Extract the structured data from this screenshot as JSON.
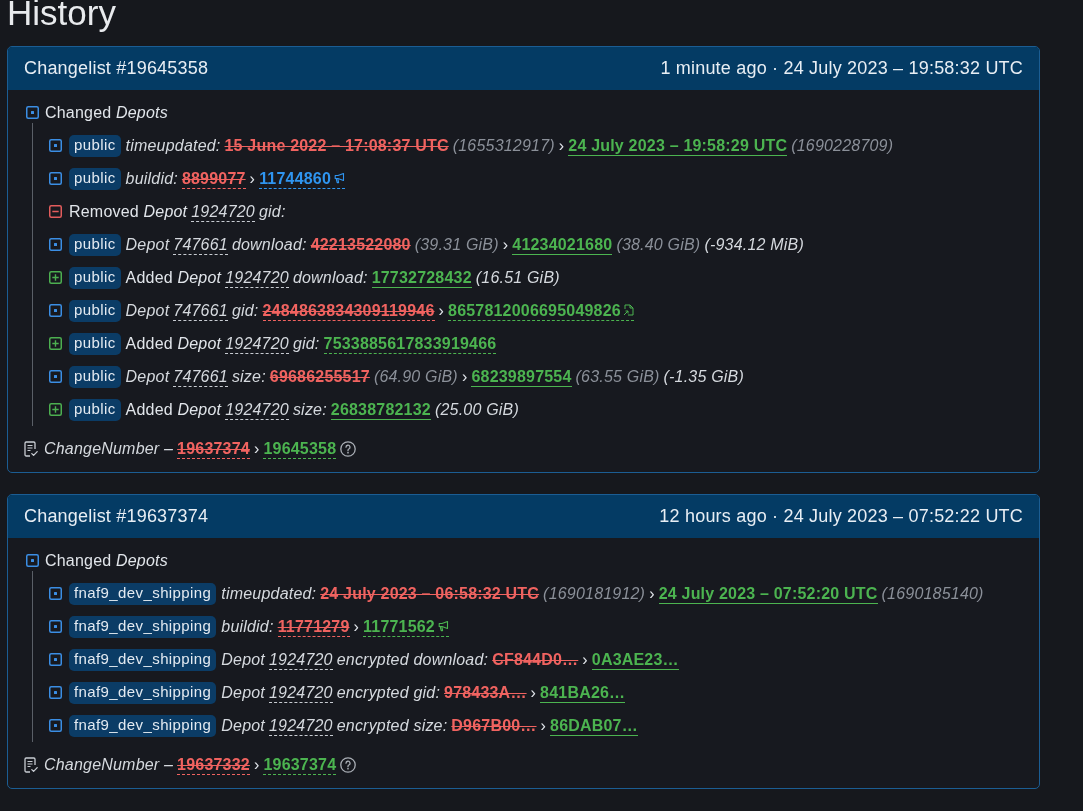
{
  "page": {
    "title": "History"
  },
  "changelists": [
    {
      "title": "Changelist #19645358",
      "time": "1 minute ago · 24 July 2023 – 19:58:32 UTC",
      "group": {
        "kind": "changed",
        "label": "Changed *Depots*"
      },
      "rows": [
        {
          "kind": "changed",
          "branch": "public",
          "segments": [
            {
              "kind": "italic",
              "text": "timeupdated:"
            },
            {
              "kind": "old",
              "text": "15 June 2022 – 17:08:37 UTC"
            },
            {
              "kind": "muted",
              "text": "(1655312917)"
            },
            {
              "kind": "text",
              "text": "›"
            },
            {
              "kind": "new",
              "text": "24 July 2023 – 19:58:29 UTC"
            },
            {
              "kind": "muted",
              "text": "(1690228709)"
            }
          ]
        },
        {
          "kind": "changed",
          "branch": "public",
          "segments": [
            {
              "kind": "italic",
              "text": "buildid:"
            },
            {
              "kind": "oldref",
              "text": "8899077"
            },
            {
              "kind": "text",
              "text": "›"
            },
            {
              "kind": "build",
              "text": "11744860",
              "color": "#2f95f0"
            }
          ]
        },
        {
          "kind": "removed",
          "segments": [
            {
              "kind": "text",
              "text": "Removed *Depot*"
            },
            {
              "kind": "depot",
              "text": "1924720"
            },
            {
              "kind": "italic",
              "text": "gid:"
            }
          ]
        },
        {
          "kind": "changed",
          "branch": "public",
          "segments": [
            {
              "kind": "italic",
              "text": "Depot"
            },
            {
              "kind": "depot",
              "text": "747661"
            },
            {
              "kind": "italic",
              "text": "download:"
            },
            {
              "kind": "old",
              "text": "42213522080"
            },
            {
              "kind": "muted",
              "text": "(39.31 GiB)"
            },
            {
              "kind": "text",
              "text": "›"
            },
            {
              "kind": "new",
              "text": "41234021680"
            },
            {
              "kind": "muted",
              "text": "(38.40 GiB)"
            },
            {
              "kind": "italic",
              "text": "(-934.12 MiB)"
            }
          ]
        },
        {
          "kind": "added",
          "branch": "public",
          "segments": [
            {
              "kind": "text",
              "text": "Added *Depot*"
            },
            {
              "kind": "depot",
              "text": "1924720"
            },
            {
              "kind": "italic",
              "text": "download:"
            },
            {
              "kind": "new",
              "text": "17732728432"
            },
            {
              "kind": "italic",
              "text": "(16.51 GiB)"
            }
          ]
        },
        {
          "kind": "changed",
          "branch": "public",
          "segments": [
            {
              "kind": "italic",
              "text": "Depot"
            },
            {
              "kind": "depot",
              "text": "747661"
            },
            {
              "kind": "italic",
              "text": "gid:"
            },
            {
              "kind": "oldref",
              "text": "2484863834309119946"
            },
            {
              "kind": "text",
              "text": "›"
            },
            {
              "kind": "hash",
              "text": "8657812006695049826"
            }
          ]
        },
        {
          "kind": "added",
          "branch": "public",
          "segments": [
            {
              "kind": "text",
              "text": "Added *Depot*"
            },
            {
              "kind": "depot",
              "text": "1924720"
            },
            {
              "kind": "italic",
              "text": "gid:"
            },
            {
              "kind": "newref",
              "text": "7533885617833919466"
            }
          ]
        },
        {
          "kind": "changed",
          "branch": "public",
          "segments": [
            {
              "kind": "italic",
              "text": "Depot"
            },
            {
              "kind": "depot",
              "text": "747661"
            },
            {
              "kind": "italic",
              "text": "size:"
            },
            {
              "kind": "old",
              "text": "69686255517"
            },
            {
              "kind": "muted",
              "text": "(64.90 GiB)"
            },
            {
              "kind": "text",
              "text": "›"
            },
            {
              "kind": "new",
              "text": "68239897554"
            },
            {
              "kind": "muted",
              "text": "(63.55 GiB)"
            },
            {
              "kind": "italic",
              "text": "(-1.35 GiB)"
            }
          ]
        },
        {
          "kind": "added",
          "branch": "public",
          "segments": [
            {
              "kind": "text",
              "text": "Added *Depot*"
            },
            {
              "kind": "depot",
              "text": "1924720"
            },
            {
              "kind": "italic",
              "text": "size:"
            },
            {
              "kind": "new",
              "text": "26838782132"
            },
            {
              "kind": "italic",
              "text": "(25.00 GiB)"
            }
          ]
        }
      ],
      "change_number": [
        {
          "kind": "italic",
          "text": "ChangeNumber –"
        },
        {
          "kind": "oldref",
          "text": "19637374"
        },
        {
          "kind": "text",
          "text": "›"
        },
        {
          "kind": "newref",
          "text": "19645358"
        }
      ]
    },
    {
      "title": "Changelist #19637374",
      "time": "12 hours ago · 24 July 2023 – 07:52:22 UTC",
      "group": {
        "kind": "changed",
        "label": "Changed *Depots*"
      },
      "rows": [
        {
          "kind": "changed",
          "branch": "fnaf9_dev_shipping",
          "segments": [
            {
              "kind": "italic",
              "text": "timeupdated:"
            },
            {
              "kind": "old",
              "text": "24 July 2023 – 06:58:32 UTC"
            },
            {
              "kind": "muted",
              "text": "(1690181912)"
            },
            {
              "kind": "text",
              "text": "›"
            },
            {
              "kind": "new",
              "text": "24 July 2023 – 07:52:20 UTC"
            },
            {
              "kind": "muted",
              "text": "(1690185140)"
            }
          ]
        },
        {
          "kind": "changed",
          "branch": "fnaf9_dev_shipping",
          "segments": [
            {
              "kind": "italic",
              "text": "buildid:"
            },
            {
              "kind": "oldref",
              "text": "11771279"
            },
            {
              "kind": "text",
              "text": "›"
            },
            {
              "kind": "build",
              "text": "11771562"
            }
          ]
        },
        {
          "kind": "changed",
          "branch": "fnaf9_dev_shipping",
          "segments": [
            {
              "kind": "italic",
              "text": "Depot"
            },
            {
              "kind": "depot",
              "text": "1924720"
            },
            {
              "kind": "italic",
              "text": "encrypted download:"
            },
            {
              "kind": "old",
              "text": "CF844D0…"
            },
            {
              "kind": "text",
              "text": "›"
            },
            {
              "kind": "new",
              "text": "0A3AE23…"
            }
          ]
        },
        {
          "kind": "changed",
          "branch": "fnaf9_dev_shipping",
          "segments": [
            {
              "kind": "italic",
              "text": "Depot"
            },
            {
              "kind": "depot",
              "text": "1924720"
            },
            {
              "kind": "italic",
              "text": "encrypted gid:"
            },
            {
              "kind": "old",
              "text": "978433A…"
            },
            {
              "kind": "text",
              "text": "›"
            },
            {
              "kind": "new",
              "text": "841BA26…"
            }
          ]
        },
        {
          "kind": "changed",
          "branch": "fnaf9_dev_shipping",
          "segments": [
            {
              "kind": "italic",
              "text": "Depot"
            },
            {
              "kind": "depot",
              "text": "1924720"
            },
            {
              "kind": "italic",
              "text": "encrypted size:"
            },
            {
              "kind": "old",
              "text": "D967B00…"
            },
            {
              "kind": "text",
              "text": "›"
            },
            {
              "kind": "new",
              "text": "86DAB07…"
            }
          ]
        }
      ],
      "change_number": [
        {
          "kind": "italic",
          "text": "ChangeNumber –"
        },
        {
          "kind": "oldref",
          "text": "19637332"
        },
        {
          "kind": "text",
          "text": "›"
        },
        {
          "kind": "newref",
          "text": "19637374"
        }
      ]
    }
  ]
}
